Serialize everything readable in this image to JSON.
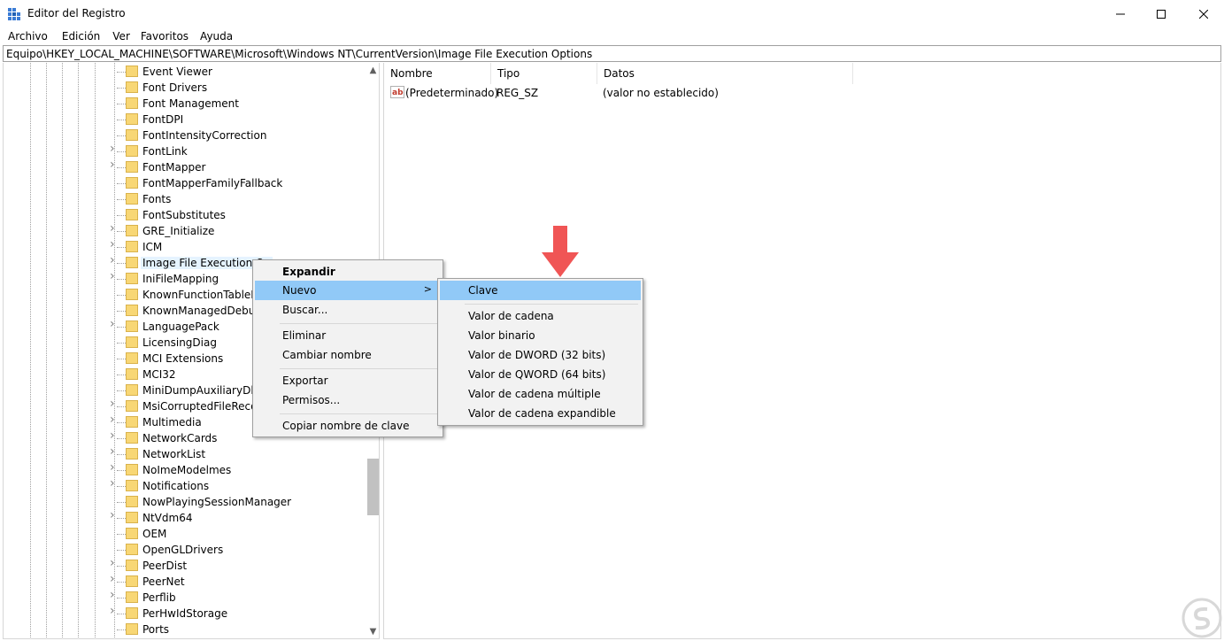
{
  "window": {
    "title": "Editor del Registro",
    "minimize_glyph": "—",
    "maximize_glyph": "☐",
    "close_glyph": "✕"
  },
  "menu": [
    "Archivo",
    "Edición",
    "Ver",
    "Favoritos",
    "Ayuda"
  ],
  "address": {
    "path": "Equipo\\HKEY_LOCAL_MACHINE\\SOFTWARE\\Microsoft\\Windows NT\\CurrentVersion\\Image File Execution Options"
  },
  "tree": {
    "items": [
      {
        "label": "Event Viewer",
        "expandable": false
      },
      {
        "label": "Font Drivers",
        "expandable": false
      },
      {
        "label": "Font Management",
        "expandable": false
      },
      {
        "label": "FontDPI",
        "expandable": false
      },
      {
        "label": "FontIntensityCorrection",
        "expandable": false
      },
      {
        "label": "FontLink",
        "expandable": true
      },
      {
        "label": "FontMapper",
        "expandable": true
      },
      {
        "label": "FontMapperFamilyFallback",
        "expandable": false
      },
      {
        "label": "Fonts",
        "expandable": false
      },
      {
        "label": "FontSubstitutes",
        "expandable": false
      },
      {
        "label": "GRE_Initialize",
        "expandable": true
      },
      {
        "label": "ICM",
        "expandable": true
      },
      {
        "label": "Image File Execution Op",
        "expandable": true,
        "selected": true
      },
      {
        "label": "IniFileMapping",
        "expandable": true
      },
      {
        "label": "KnownFunctionTableDl",
        "expandable": false
      },
      {
        "label": "KnownManagedDebugg",
        "expandable": false
      },
      {
        "label": "LanguagePack",
        "expandable": true
      },
      {
        "label": "LicensingDiag",
        "expandable": false
      },
      {
        "label": "MCI Extensions",
        "expandable": false
      },
      {
        "label": "MCI32",
        "expandable": false
      },
      {
        "label": "MiniDumpAuxiliaryDlls",
        "expandable": false
      },
      {
        "label": "MsiCorruptedFileRecov",
        "expandable": true
      },
      {
        "label": "Multimedia",
        "expandable": true
      },
      {
        "label": "NetworkCards",
        "expandable": true
      },
      {
        "label": "NetworkList",
        "expandable": true
      },
      {
        "label": "NoImeModelmes",
        "expandable": true
      },
      {
        "label": "Notifications",
        "expandable": true
      },
      {
        "label": "NowPlayingSessionManager",
        "expandable": false
      },
      {
        "label": "NtVdm64",
        "expandable": true
      },
      {
        "label": "OEM",
        "expandable": false
      },
      {
        "label": "OpenGLDrivers",
        "expandable": false
      },
      {
        "label": "PeerDist",
        "expandable": true
      },
      {
        "label": "PeerNet",
        "expandable": true
      },
      {
        "label": "Perflib",
        "expandable": true
      },
      {
        "label": "PerHwIdStorage",
        "expandable": true
      },
      {
        "label": "Ports",
        "expandable": false
      }
    ]
  },
  "list": {
    "columns": [
      "Nombre",
      "Tipo",
      "Datos"
    ],
    "rows": [
      {
        "name": "(Predeterminado)",
        "type": "REG_SZ",
        "data": "(valor no establecido)"
      }
    ]
  },
  "context_menu": {
    "expand": "Expandir",
    "new": "Nuevo",
    "find": "Buscar...",
    "delete": "Eliminar",
    "rename": "Cambiar nombre",
    "export": "Exportar",
    "permissions": "Permisos...",
    "copy_key_name": "Copiar nombre de clave",
    "arrow_glyph": ">"
  },
  "submenu": {
    "key": "Clave",
    "string_value": "Valor de cadena",
    "binary_value": "Valor binario",
    "dword_value": "Valor de DWORD (32 bits)",
    "qword_value": "Valor de QWORD (64 bits)",
    "multi_string_value": "Valor de cadena múltiple",
    "expandable_string_value": "Valor de cadena expandible"
  },
  "scroll": {
    "up_glyph": "▲",
    "down_glyph": "▼"
  },
  "colors": {
    "highlight": "#91c9f7",
    "arrow": "#f05555",
    "folder": "#f8d775"
  }
}
